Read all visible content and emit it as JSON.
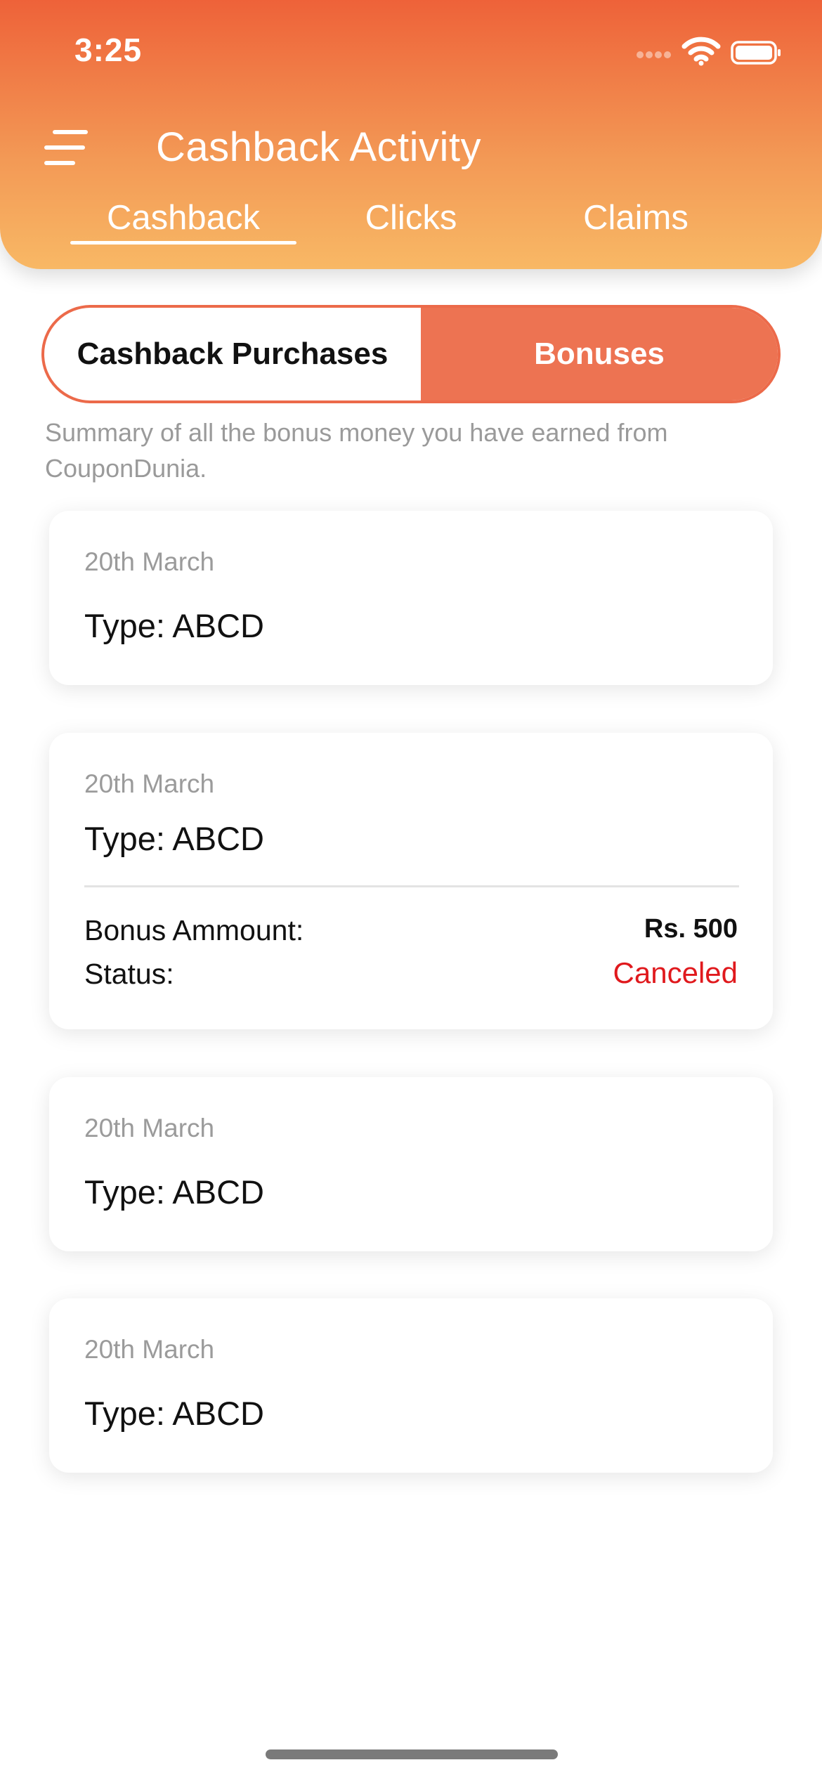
{
  "status_bar": {
    "time": "3:25"
  },
  "header": {
    "title": "Cashback Activity",
    "tabs": [
      {
        "label": "Cashback",
        "active": true
      },
      {
        "label": "Clicks",
        "active": false
      },
      {
        "label": "Claims",
        "active": false
      }
    ]
  },
  "segment": {
    "left_label": "Cashback Purchases",
    "right_label": "Bonuses",
    "selected": "Bonuses"
  },
  "summary": "Summary of all the bonus money you have earned from CouponDunia.",
  "cards": [
    {
      "date": "20th March",
      "type": "Type: ABCD"
    },
    {
      "date": "20th March",
      "type": "Type: ABCD",
      "bonus_label": "Bonus Ammount:",
      "bonus_value": "Rs. 500",
      "status_label": "Status:",
      "status_value": "Canceled"
    },
    {
      "date": "20th March",
      "type": "Type: ABCD"
    },
    {
      "date": "20th March",
      "type": "Type: ABCD"
    }
  ],
  "colors": {
    "header_top": "#ee6239",
    "header_bottom": "#f8b865",
    "accent": "#ed7352",
    "status_canceled": "#e0191d"
  }
}
